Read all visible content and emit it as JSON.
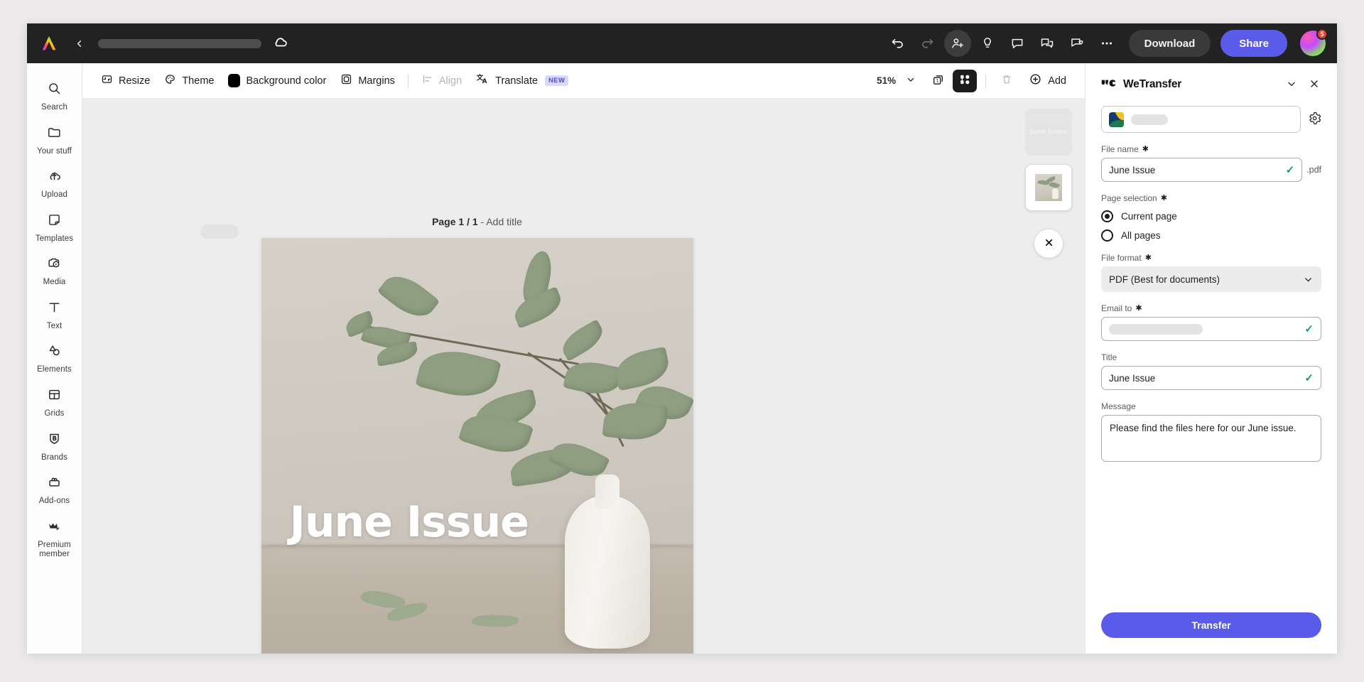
{
  "top_bar": {
    "logo_name": "adobe-express-logo",
    "back_label": "Back",
    "doc_title_value": "",
    "cloud_status": "saved-to-cloud",
    "undo_label": "Undo",
    "redo_label": "Redo",
    "invite_label": "Invite",
    "ideas_label": "Ideas",
    "comment_label": "Comment",
    "chat_label": "Chat",
    "feedback_label": "Feedback",
    "more_label": "More options",
    "download_label": "Download",
    "share_label": "Share",
    "avatar_badge": "5"
  },
  "sidebar": {
    "items": [
      {
        "label": "Search",
        "icon": "search-icon"
      },
      {
        "label": "Your stuff",
        "icon": "folder-icon"
      },
      {
        "label": "Upload",
        "icon": "upload-cloud-icon"
      },
      {
        "label": "Templates",
        "icon": "templates-icon"
      },
      {
        "label": "Media",
        "icon": "media-icon"
      },
      {
        "label": "Text",
        "icon": "text-icon"
      },
      {
        "label": "Elements",
        "icon": "elements-icon"
      },
      {
        "label": "Grids",
        "icon": "grids-icon"
      },
      {
        "label": "Brands",
        "icon": "brands-icon"
      },
      {
        "label": "Add-ons",
        "icon": "addons-icon"
      },
      {
        "label": "Premium member",
        "icon": "crown-icon"
      }
    ]
  },
  "toolbar": {
    "resize_label": "Resize",
    "theme_label": "Theme",
    "background_color_label": "Background color",
    "background_color_value": "#000000",
    "margins_label": "Margins",
    "align_label": "Align",
    "translate_label": "Translate",
    "translate_badge": "NEW",
    "zoom_value": "51%",
    "pages_label": "Pages",
    "layers_label": "Layers",
    "delete_label": "Delete",
    "add_label": "Add"
  },
  "canvas": {
    "page_label_bold": "Page 1 / 1",
    "page_label_rest": " - Add title",
    "artboard_title": "June Issue",
    "thumbnails": [
      {
        "name": "page-thumbnail-1",
        "caption": "June Issue",
        "selected": false
      },
      {
        "name": "page-thumbnail-2",
        "caption": "",
        "selected": true
      }
    ],
    "close_label": "Close"
  },
  "panel": {
    "app_name": "WeTransfer",
    "collapse_label": "Collapse",
    "close_label": "Close",
    "account_redacted": true,
    "settings_label": "Settings",
    "file_name": {
      "label": "File name",
      "required": "✱",
      "value": "June Issue",
      "extension": ".pdf",
      "valid": "✓"
    },
    "page_selection": {
      "label": "Page selection",
      "required": "✱",
      "options": [
        {
          "label": "Current page",
          "selected": true
        },
        {
          "label": "All pages",
          "selected": false
        }
      ]
    },
    "file_format": {
      "label": "File format",
      "required": "✱",
      "value": "PDF (Best for documents)"
    },
    "email_to": {
      "label": "Email to",
      "required": "✱",
      "value": "",
      "valid": "✓"
    },
    "title": {
      "label": "Title",
      "value": "June Issue",
      "valid": "✓"
    },
    "message": {
      "label": "Message",
      "value": "Please find the files here for our June issue."
    },
    "transfer_label": "Transfer"
  },
  "colors": {
    "accent": "#5b5bea",
    "topbar": "#222222",
    "valid_green": "#16a05c",
    "badge_red": "#e8432c",
    "new_badge_bg": "#d9d9ff",
    "new_badge_fg": "#4a4ae0"
  }
}
